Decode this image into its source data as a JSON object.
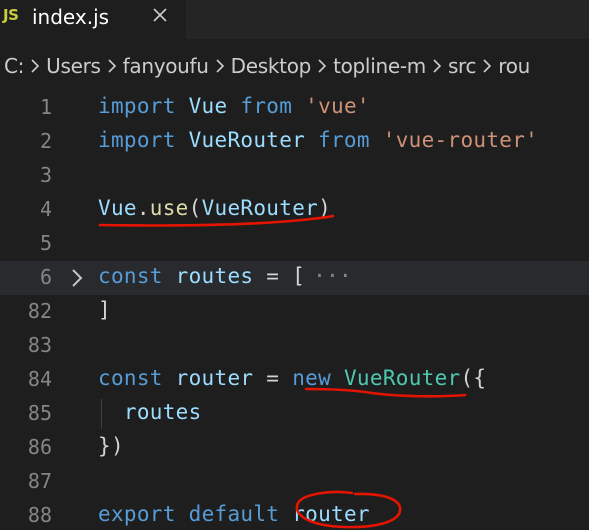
{
  "tab": {
    "icon": "JS",
    "title": "index.js",
    "close": "✕"
  },
  "breadcrumb": {
    "segments": [
      "C:",
      "Users",
      "fanyoufu",
      "Desktop",
      "topline-m",
      "src",
      "rou"
    ]
  },
  "editor": {
    "lines": [
      {
        "num": "1",
        "tokens": [
          {
            "t": "import",
            "c": "kw"
          },
          {
            "t": " Vue ",
            "c": "var"
          },
          {
            "t": "from",
            "c": "kw"
          },
          {
            "t": " ",
            "c": "plain"
          },
          {
            "t": "'vue'",
            "c": "str"
          }
        ]
      },
      {
        "num": "2",
        "tokens": [
          {
            "t": "import",
            "c": "kw"
          },
          {
            "t": " VueRouter ",
            "c": "var"
          },
          {
            "t": "from",
            "c": "kw"
          },
          {
            "t": " ",
            "c": "plain"
          },
          {
            "t": "'vue-router'",
            "c": "str"
          }
        ]
      },
      {
        "num": "3",
        "tokens": []
      },
      {
        "num": "4",
        "tokens": [
          {
            "t": "Vue",
            "c": "var"
          },
          {
            "t": ".",
            "c": "plain"
          },
          {
            "t": "use",
            "c": "fn"
          },
          {
            "t": "(",
            "c": "plain"
          },
          {
            "t": "VueRouter",
            "c": "var"
          },
          {
            "t": ")",
            "c": "plain"
          }
        ]
      },
      {
        "num": "5",
        "tokens": []
      },
      {
        "num": "6",
        "tokens": [
          {
            "t": "const",
            "c": "kw"
          },
          {
            "t": " ",
            "c": "plain"
          },
          {
            "t": "routes",
            "c": "var"
          },
          {
            "t": " = [",
            "c": "plain"
          }
        ],
        "folded": true,
        "fold_marker": "···"
      },
      {
        "num": "82",
        "tokens": [
          {
            "t": "]",
            "c": "plain"
          }
        ]
      },
      {
        "num": "83",
        "tokens": []
      },
      {
        "num": "84",
        "tokens": [
          {
            "t": "const",
            "c": "kw"
          },
          {
            "t": " ",
            "c": "plain"
          },
          {
            "t": "router",
            "c": "var"
          },
          {
            "t": " = ",
            "c": "plain"
          },
          {
            "t": "new",
            "c": "kw"
          },
          {
            "t": " ",
            "c": "plain"
          },
          {
            "t": "VueRouter",
            "c": "cls"
          },
          {
            "t": "({",
            "c": "plain"
          }
        ]
      },
      {
        "num": "85",
        "tokens": [
          {
            "t": "  ",
            "c": "plain"
          },
          {
            "t": "routes",
            "c": "var"
          }
        ]
      },
      {
        "num": "86",
        "tokens": [
          {
            "t": "})",
            "c": "plain"
          }
        ]
      },
      {
        "num": "87",
        "tokens": []
      },
      {
        "num": "88",
        "tokens": [
          {
            "t": "export",
            "c": "kw"
          },
          {
            "t": " ",
            "c": "plain"
          },
          {
            "t": "default",
            "c": "kw"
          },
          {
            "t": " ",
            "c": "plain"
          },
          {
            "t": "router",
            "c": "var"
          }
        ]
      }
    ]
  },
  "colors": {
    "background": "#1e1e1e",
    "tabbar": "#252526",
    "keyword": "#569cd6",
    "string": "#ce9178",
    "variable": "#9cdcfe",
    "class": "#4ec9b0",
    "function": "#dcdcaa",
    "line_number": "#858585",
    "annotation": "#e51400"
  },
  "icons": {
    "tab_file": "js-file-icon",
    "tab_close": "close-icon",
    "breadcrumb_sep": "chevron-right-icon",
    "fold": "chevron-right-icon"
  }
}
